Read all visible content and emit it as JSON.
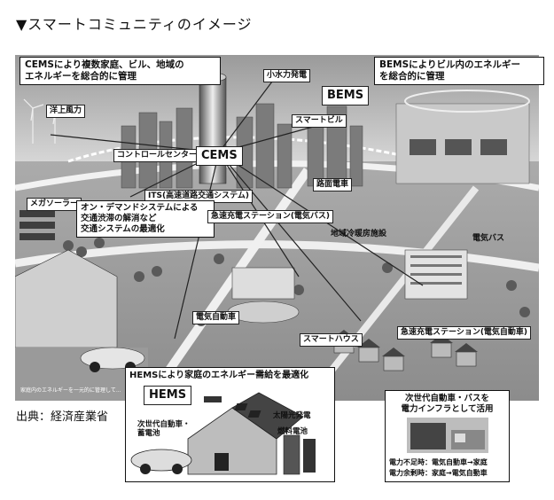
{
  "heading": "▼スマートコミュニティのイメージ",
  "source": "出典：経済産業省",
  "diagram": {
    "cems_box": [
      "CEMSにより複数家庭、ビル、地域の",
      "エネルギーを総合的に管理"
    ],
    "bems_box": [
      "BEMSによりビル内のエネルギー",
      "を総合的に管理"
    ],
    "bems_label": "BEMS",
    "cems_label": "CEMS",
    "labels": {
      "small_hydro": "小水力発電",
      "offshore_wind": "洋上風力",
      "smart_building": "スマートビル",
      "control_center": "コントロールセンター",
      "tram": "路面電車",
      "its": "ITS(高速道路交通システム)",
      "mega_solar": "メガソーラー",
      "quick_charge_bus": "急速充電ステーション(電気バス)",
      "district_heating": "地域冷暖房施設",
      "electric_bus": "電気バス",
      "electric_car": "電気自動車",
      "smart_house": "スマートハウス",
      "quick_charge_car": "急速充電ステーション(電気自動車)",
      "small_note": "家庭内のエネルギーを一元的に管理して..."
    },
    "ondemand_box": [
      "オン・デマンドシステムによる",
      "交通渋滞の解消など",
      "交通システムの最適化"
    ],
    "hems_box": {
      "title": "HEMSにより家庭のエネルギー需給を最適化",
      "label": "HEMS",
      "next_gen": [
        "次世代自動車・",
        "蓄電池"
      ],
      "solar": "太陽光発電",
      "fuel_cell": "燃料電池"
    },
    "vehicle_box": {
      "title": [
        "次世代自動車・バスを",
        "電力インフラとして活用"
      ],
      "shortage": "電力不足時：電気自動車→家庭",
      "surplus": "電力余剰時：家庭→電気自動車"
    }
  }
}
